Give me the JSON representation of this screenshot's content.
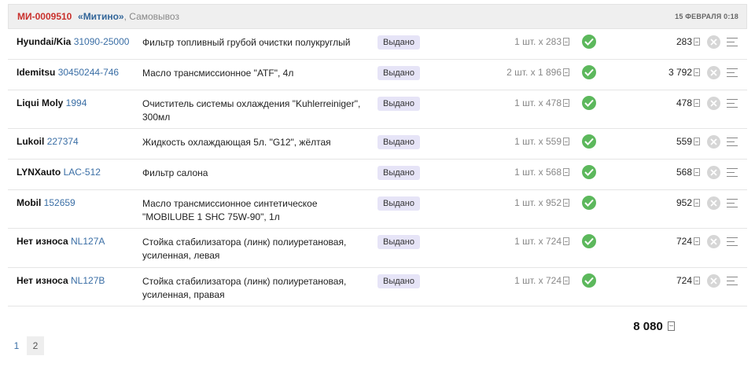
{
  "order": {
    "id": "МИ-0009510",
    "store_open_quote": "«",
    "store_name": "Митино",
    "store_close_quote": "»",
    "pickup": ", Самовывоз",
    "date": "15 ФЕВРАЛЯ 0:18"
  },
  "items": [
    {
      "brand": "Hyundai/Kia",
      "code": "31090-25000",
      "name": "Фильтр топливный грубой очистки полукруглый",
      "status": "Выдано",
      "qty": "1 шт. x 283",
      "sum": "283"
    },
    {
      "brand": "Idemitsu",
      "code": "30450244-746",
      "name": "Масло трансмиссионное \"ATF\", 4л",
      "status": "Выдано",
      "qty": "2 шт. x 1 896",
      "sum": "3 792"
    },
    {
      "brand": "Liqui Moly",
      "code": "1994",
      "name": "Очиститель системы охлаждения \"Kuhlerreiniger\", 300мл",
      "status": "Выдано",
      "qty": "1 шт. x 478",
      "sum": "478"
    },
    {
      "brand": "Lukoil",
      "code": "227374",
      "name": "Жидкость охлаждающая 5л. \"G12\", жёлтая",
      "status": "Выдано",
      "qty": "1 шт. x 559",
      "sum": "559"
    },
    {
      "brand": "LYNXauto",
      "code": "LAC-512",
      "name": "Фильтр салона",
      "status": "Выдано",
      "qty": "1 шт. x 568",
      "sum": "568"
    },
    {
      "brand": "Mobil",
      "code": "152659",
      "name": "Масло трансмиссионное синтетическое \"MOBILUBE 1 SHC 75W-90\", 1л",
      "status": "Выдано",
      "qty": "1 шт. x 952",
      "sum": "952"
    },
    {
      "brand": "Нет износа",
      "code": "NL127A",
      "name": "Стойка стабилизатора (линк) полиуретановая, усиленная, левая",
      "status": "Выдано",
      "qty": "1 шт. x 724",
      "sum": "724"
    },
    {
      "brand": "Нет износа",
      "code": "NL127B",
      "name": "Стойка стабилизатора (линк) полиуретановая, усиленная, правая",
      "status": "Выдано",
      "qty": "1 шт. x 724",
      "sum": "724"
    }
  ],
  "total": "8 080",
  "pagination": [
    "1",
    "2"
  ],
  "colors": {
    "order_id": "#c9302c",
    "link": "#3a6ea5",
    "status_bg": "#e6e4f7",
    "check": "#5cb85c",
    "delete": "#d6d6d6"
  }
}
